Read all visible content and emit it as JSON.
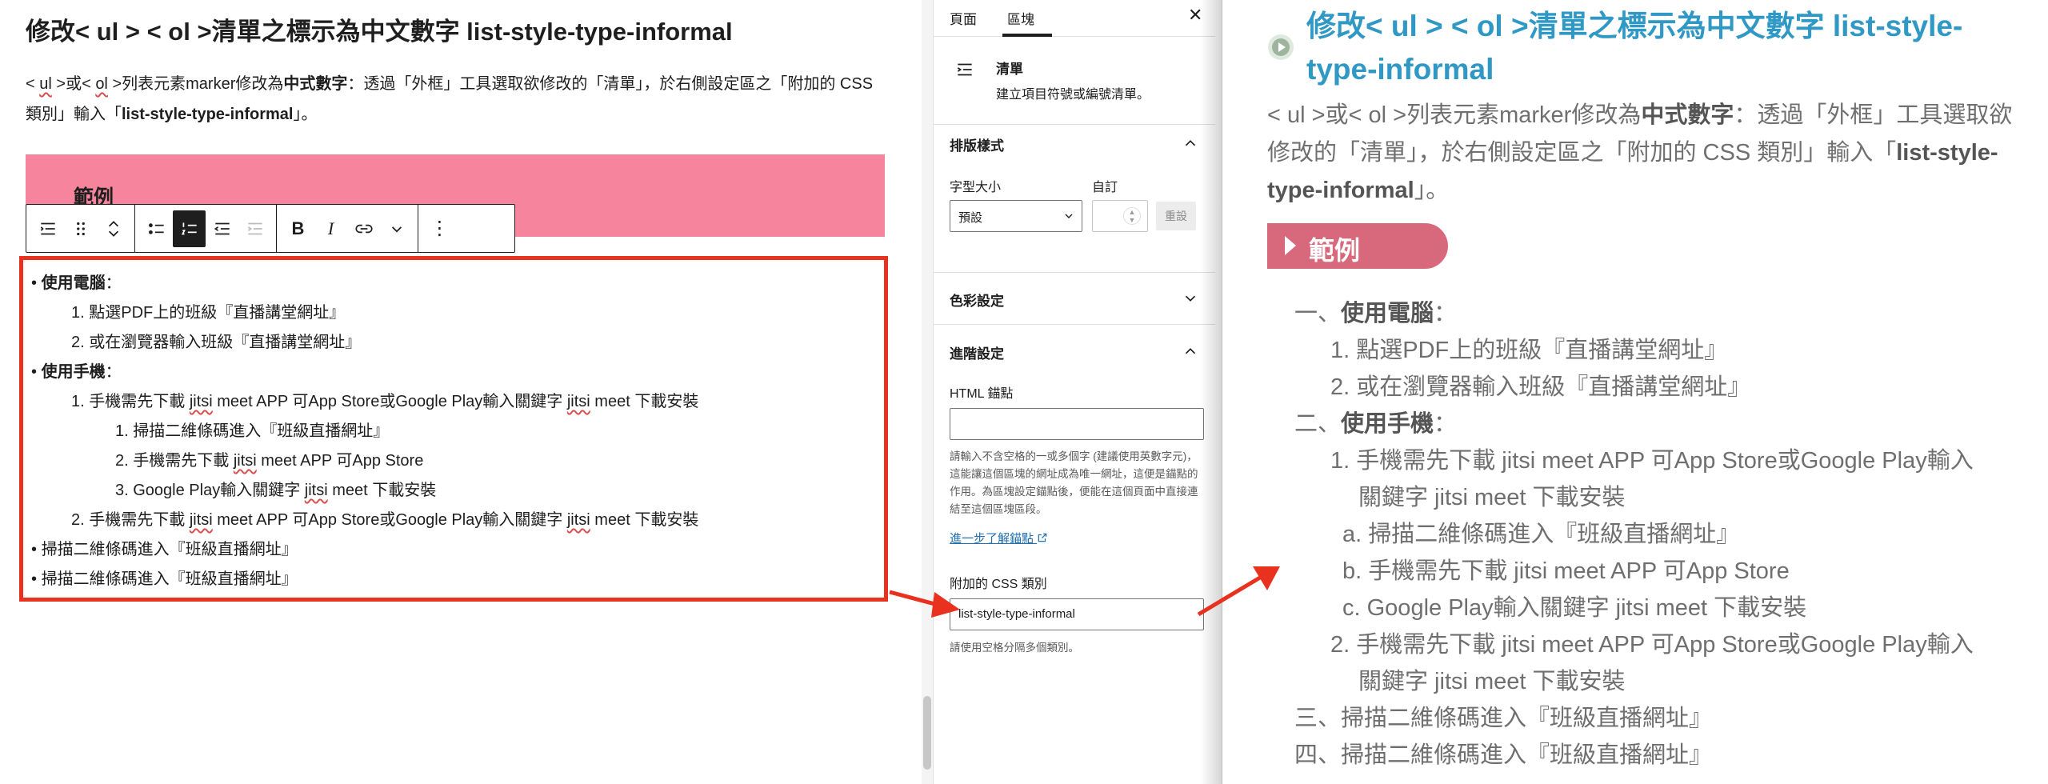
{
  "editor": {
    "title": "修改< ul > < ol >清單之標示為中文數字 list-style-type-informal",
    "para_1": "< ",
    "para_ul": "ul",
    "para_2": " >或< ",
    "para_ol": "ol",
    "para_3": " >列表元素marker修改為",
    "para_bold": "中式數字",
    "para_4": "：透過「外框」工具選取欲修改的「清單」，於右側設定區之「附加的 CSS 類別」輸入「",
    "para_bold2": "list-style-type-informal",
    "para_5": "」。",
    "banner_text": "範例",
    "list": [
      {
        "marker": "•",
        "bold": "使用電腦",
        "text": "："
      },
      {
        "marker": "1.",
        "text": "點選PDF上的班級『直播講堂網址』"
      },
      {
        "marker": "2.",
        "text": "或在瀏覽器輸入班級『直播講堂網址』"
      },
      {
        "marker": "•",
        "bold": "使用手機",
        "text": "："
      },
      {
        "marker": "1.",
        "text_a": "手機需先下載 ",
        "word_a": "jitsi",
        "text_b": " meet APP 可App Store或Google Play輸入關鍵字 ",
        "word_b": "jitsi",
        "text_c": " meet 下載安裝"
      },
      {
        "marker": "1.",
        "text": "掃描二維條碼進入『班級直播網址』"
      },
      {
        "marker": "2.",
        "text_a": "手機需先下載 ",
        "word_a": "jitsi",
        "text_b": " meet APP 可App Store"
      },
      {
        "marker": "3.",
        "text_a": "Google Play輸入關鍵字 ",
        "word_a": "jitsi",
        "text_b": " meet 下載安裝"
      },
      {
        "marker": "2.",
        "text_a": "手機需先下載 ",
        "word_a": "jitsi",
        "text_b": " meet APP 可App Store或Google Play輸入關鍵字 ",
        "word_b": "jitsi",
        "text_c": " meet 下載安裝"
      },
      {
        "marker": "•",
        "text": "掃描二維條碼進入『班級直播網址』"
      },
      {
        "marker": "•",
        "text": "掃描二維條碼進入『班級直播網址』"
      }
    ]
  },
  "toolbar": {
    "buttons": [
      "list-view",
      "drag",
      "move-up-down",
      "unordered-list",
      "ordered-list",
      "outdent",
      "indent",
      "bold",
      "italic",
      "link",
      "more-rich-text",
      "options"
    ],
    "bold_label": "B",
    "italic_label": "I",
    "options_label": "⋮"
  },
  "sidebar": {
    "tab_page": "頁面",
    "tab_block": "區塊",
    "close": "✕",
    "block_title": "清單",
    "block_desc": "建立項目符號或編號清單。",
    "typography_heading": "排版樣式",
    "font_size_label": "字型大小",
    "custom_label": "自訂",
    "font_size_value": "預設",
    "reset_label": "重設",
    "color_heading": "色彩設定",
    "advanced_heading": "進階設定",
    "html_anchor_label": "HTML 錨點",
    "html_anchor_help": "請輸入不含空格的一或多個字 (建議使用英數字元)，這能讓這個區塊的網址成為唯一網址，這便是錨點的作用。為區塊設定錨點後，便能在這個頁面中直接連結至這個區塊區段。",
    "learn_more_link": "進一步了解錨點",
    "css_class_label": "附加的 CSS 類別",
    "css_class_value": "list-style-type-informal",
    "css_class_help": "請使用空格分隔多個類別。"
  },
  "preview": {
    "title": "修改< ul > < ol >清單之標示為中文數字 list-style-type-informal",
    "para_1": "< ul >或< ol >列表元素marker修改為",
    "para_bold": "中式數字",
    "para_2": "：透過「外框」工具選取欲修改的「清單」，於右側設定區之「附加的 CSS 類別」輸入「",
    "para_bold2": "list-style-type-informal",
    "para_3": "」。",
    "badge": "範例",
    "list": [
      {
        "marker": "一、",
        "bold": "使用電腦",
        "text": "："
      },
      {
        "marker": "1.",
        "text": "點選PDF上的班級『直播講堂網址』"
      },
      {
        "marker": "2.",
        "text": "或在瀏覽器輸入班級『直播講堂網址』"
      },
      {
        "marker": "二、",
        "bold": "使用手機",
        "text": "："
      },
      {
        "marker": "1.",
        "text": "手機需先下載 jitsi meet APP 可App Store或Google Play輸入"
      },
      {
        "marker": "",
        "text": "關鍵字 jitsi meet 下載安裝"
      },
      {
        "marker": "a.",
        "text": "掃描二維條碼進入『班級直播網址』"
      },
      {
        "marker": "b.",
        "text": "手機需先下載 jitsi meet APP 可App Store"
      },
      {
        "marker": "c.",
        "text": "Google Play輸入關鍵字 jitsi meet 下載安裝"
      },
      {
        "marker": "2.",
        "text": "手機需先下載 jitsi meet APP 可App Store或Google Play輸入"
      },
      {
        "marker": "",
        "text": "關鍵字 jitsi meet 下載安裝"
      },
      {
        "marker": "三、",
        "text": "掃描二維條碼進入『班級直播網址』"
      },
      {
        "marker": "四、",
        "text": "掃描二維條碼進入『班級直播網址』"
      }
    ]
  },
  "colors": {
    "highlight_border": "#e8321f",
    "banner_pink": "#f5849c",
    "preview_title_blue": "#2f98c4",
    "preview_badge": "#d8697c",
    "link_blue": "#2271b1"
  }
}
